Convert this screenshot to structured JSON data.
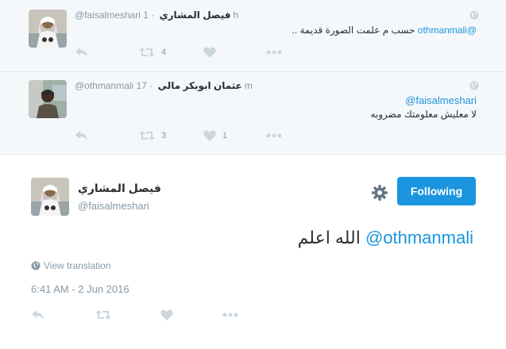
{
  "replies": [
    {
      "handle": "@faisalmeshari",
      "fullname": "فيصل المشاري",
      "time": "· 1h",
      "text_mention": "@othmanmali",
      "text_body": "حسب م علمت الصورة قديمة ..",
      "retweet_count": "4",
      "like_count": ""
    },
    {
      "handle": "@othmanmali",
      "fullname": "عثمان ابوبكر مالي",
      "time": "· 17m",
      "text_line1": "@faisalmeshari",
      "text_line2": "لا معليش معلومتك مضروبه",
      "retweet_count": "3",
      "like_count": "1"
    }
  ],
  "main": {
    "fullname": "فيصل المشاري",
    "handle": "@faisalmeshari",
    "follow_label": "Following",
    "text_mention": "@othmanmali",
    "text_body": "الله اعلم",
    "view_translation": "View translation",
    "timestamp": "6:41 AM - 2 Jun 2016"
  },
  "icons": {
    "reply": "reply-icon",
    "retweet": "retweet-icon",
    "like": "heart-icon",
    "more": "more-icon",
    "gear": "gear-icon",
    "globe": "globe-icon"
  },
  "colors": {
    "accent": "#1b95e0",
    "muted": "#8899a6",
    "reply_bg": "#f5f8fa",
    "text": "#292f33"
  }
}
